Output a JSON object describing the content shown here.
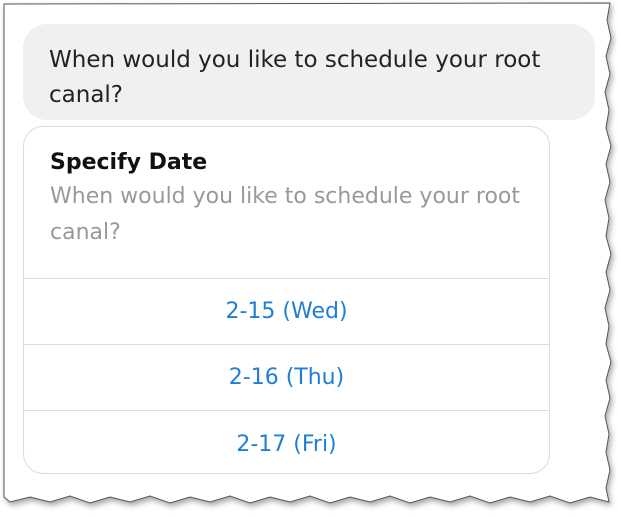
{
  "conversation": {
    "bot_message": "When would you like to schedule your root canal?"
  },
  "date_picker": {
    "title": "Specify Date",
    "prompt": "When would you like to schedule your root canal?",
    "options": [
      {
        "label": "2-15 (Wed)"
      },
      {
        "label": "2-16 (Thu)"
      },
      {
        "label": "2-17 (Fri)"
      }
    ]
  },
  "colors": {
    "bubble_background": "#f0f0f0",
    "option_link": "#1f7fd6",
    "divider": "#dcdcdc",
    "prompt_text": "#999999"
  }
}
